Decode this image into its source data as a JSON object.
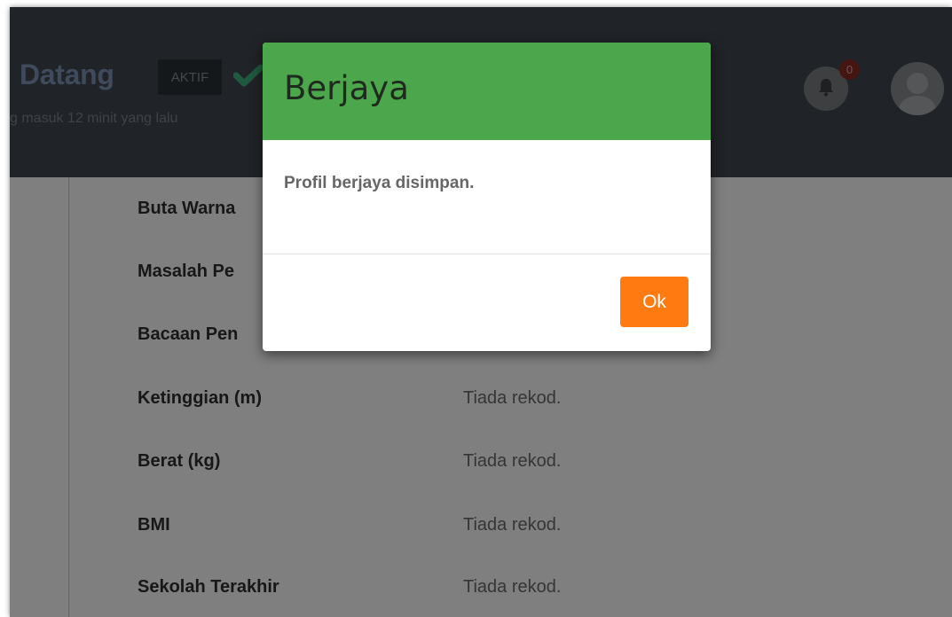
{
  "header": {
    "welcome_title": "Datang",
    "status_badge": "AKTIF",
    "last_login": "g masuk 12 minit yang lalu",
    "notification_count": "0"
  },
  "profile_rows": [
    {
      "label": "Buta Warna",
      "value": ""
    },
    {
      "label": "Masalah Pe",
      "value": ""
    },
    {
      "label": "Bacaan Pen",
      "value": ""
    },
    {
      "label": "Ketinggian (m)",
      "value": "Tiada rekod."
    },
    {
      "label": "Berat (kg)",
      "value": "Tiada rekod."
    },
    {
      "label": "BMI",
      "value": "Tiada rekod."
    },
    {
      "label": "Sekolah Terakhir",
      "value": "Tiada rekod."
    }
  ],
  "modal": {
    "title": "Berjaya",
    "message": "Profil berjaya disimpan.",
    "ok_label": "Ok"
  },
  "colors": {
    "header_bg": "#40474f",
    "modal_header": "#4ca74c",
    "ok_button": "#ff7b12",
    "check": "#3fb27f"
  },
  "icons": {
    "verified": "check-icon",
    "notifications": "bell-icon",
    "avatar": "user-icon"
  }
}
